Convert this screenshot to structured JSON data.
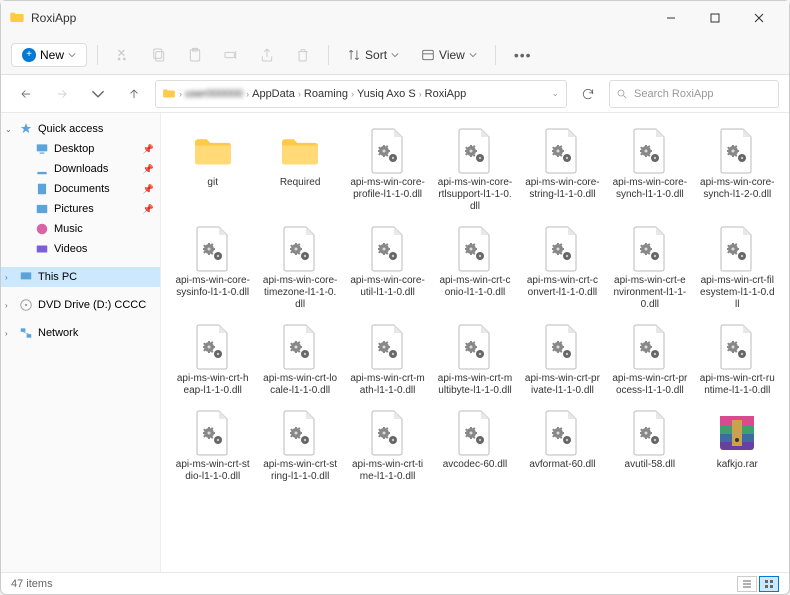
{
  "window": {
    "title": "RoxiApp"
  },
  "toolbar": {
    "new_label": "New",
    "sort_label": "Sort",
    "view_label": "View"
  },
  "breadcrumb": {
    "items": [
      "",
      "AppData",
      "Roaming",
      "Yusiq Axo S",
      "RoxiApp"
    ]
  },
  "search": {
    "placeholder": "Search RoxiApp"
  },
  "sidebar": {
    "quick": "Quick access",
    "items": [
      "Desktop",
      "Downloads",
      "Documents",
      "Pictures",
      "Music",
      "Videos"
    ],
    "thispc": "This PC",
    "dvd": "DVD Drive (D:) CCCC",
    "network": "Network"
  },
  "files": [
    {
      "name": "git",
      "type": "folder"
    },
    {
      "name": "Required",
      "type": "folder"
    },
    {
      "name": "api-ms-win-core-profile-l1-1-0.dll",
      "type": "dll"
    },
    {
      "name": "api-ms-win-core-rtlsupport-l1-1-0.dll",
      "type": "dll"
    },
    {
      "name": "api-ms-win-core-string-l1-1-0.dll",
      "type": "dll"
    },
    {
      "name": "api-ms-win-core-synch-l1-1-0.dll",
      "type": "dll"
    },
    {
      "name": "api-ms-win-core-synch-l1-2-0.dll",
      "type": "dll"
    },
    {
      "name": "api-ms-win-core-sysinfo-l1-1-0.dll",
      "type": "dll"
    },
    {
      "name": "api-ms-win-core-timezone-l1-1-0.dll",
      "type": "dll"
    },
    {
      "name": "api-ms-win-core-util-l1-1-0.dll",
      "type": "dll"
    },
    {
      "name": "api-ms-win-crt-conio-l1-1-0.dll",
      "type": "dll"
    },
    {
      "name": "api-ms-win-crt-convert-l1-1-0.dll",
      "type": "dll"
    },
    {
      "name": "api-ms-win-crt-environment-l1-1-0.dll",
      "type": "dll"
    },
    {
      "name": "api-ms-win-crt-filesystem-l1-1-0.dll",
      "type": "dll"
    },
    {
      "name": "api-ms-win-crt-heap-l1-1-0.dll",
      "type": "dll"
    },
    {
      "name": "api-ms-win-crt-locale-l1-1-0.dll",
      "type": "dll"
    },
    {
      "name": "api-ms-win-crt-math-l1-1-0.dll",
      "type": "dll"
    },
    {
      "name": "api-ms-win-crt-multibyte-l1-1-0.dll",
      "type": "dll"
    },
    {
      "name": "api-ms-win-crt-private-l1-1-0.dll",
      "type": "dll"
    },
    {
      "name": "api-ms-win-crt-process-l1-1-0.dll",
      "type": "dll"
    },
    {
      "name": "api-ms-win-crt-runtime-l1-1-0.dll",
      "type": "dll"
    },
    {
      "name": "api-ms-win-crt-stdio-l1-1-0.dll",
      "type": "dll"
    },
    {
      "name": "api-ms-win-crt-string-l1-1-0.dll",
      "type": "dll"
    },
    {
      "name": "api-ms-win-crt-time-l1-1-0.dll",
      "type": "dll"
    },
    {
      "name": "avcodec-60.dll",
      "type": "dll"
    },
    {
      "name": "avformat-60.dll",
      "type": "dll"
    },
    {
      "name": "avutil-58.dll",
      "type": "dll"
    },
    {
      "name": "kafkjo.rar",
      "type": "rar"
    }
  ],
  "status": {
    "count": "47 items"
  }
}
